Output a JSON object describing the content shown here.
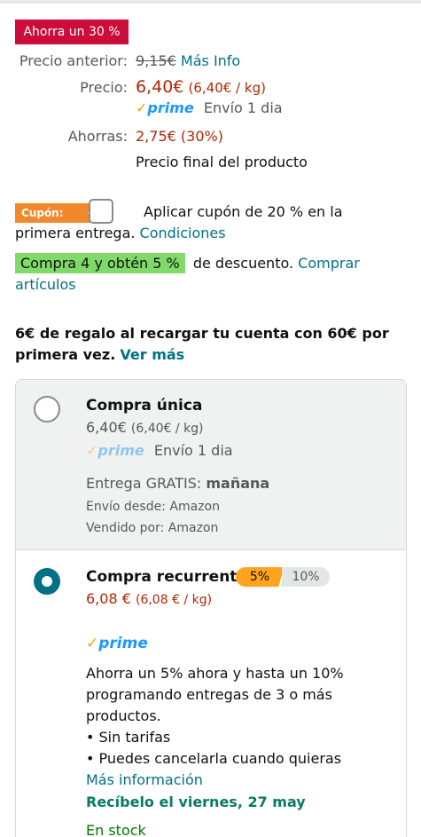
{
  "deal_badge": "Ahorra un 30 %",
  "pricing": {
    "previous_label": "Precio anterior:",
    "previous_value": "9,15€",
    "more_info": "Más Info",
    "price_label": "Precio:",
    "price_value": "6,40€",
    "price_unit": "(6,40€ / kg)",
    "prime_text": "prime",
    "delivery": "Envío 1 dia",
    "savings_label": "Ahorras:",
    "savings_value": "2,75€ (30%)",
    "final_note": "Precio final del producto"
  },
  "coupon": {
    "tag": "Cupón:",
    "text_line1": "Aplicar cupón de 20 % en la",
    "text_line2": "primera entrega.",
    "conditions": "Condiciones"
  },
  "multibuy": {
    "highlight": "Compra 4 y obtén 5 %",
    "rest": "de descuento.",
    "link1": "Comprar",
    "link2": "artículos"
  },
  "gift": {
    "line1": "6€ de regalo al recargar tu cuenta con 60€ por",
    "line2": "primera vez.",
    "link": "Ver más"
  },
  "one_time": {
    "title": "Compra única",
    "price": "6,40€",
    "unit": "(6,40€ / kg)",
    "prime_text": "prime",
    "delivery": "Envío 1 dia",
    "free_delivery_label": "Entrega GRATIS:",
    "free_delivery_day": "mañana",
    "shipped_from": "Envío desde: Amazon",
    "sold_by": "Vendido por: Amazon"
  },
  "recurring": {
    "title": "Compra recurrente",
    "pill_active": "5%",
    "pill_inactive": "10%",
    "price": "6,08 €",
    "unit": "(6,08 € / kg)",
    "prime_text": "prime",
    "desc_line1": "Ahorra un 5% ahora y hasta un 10%",
    "desc_line2": "programando entregas de 3 o más",
    "desc_line3": "productos.",
    "bullet1": "• Sin tarifas",
    "bullet2": "• Puedes cancelarla cuando quieras",
    "more_info": "Más información",
    "arrival": "Recíbelo el viernes, 27 may",
    "stock": "En stock"
  },
  "colors": {
    "deal_red": "#cc0c39",
    "price_red": "#b12704",
    "link_teal": "#007185",
    "prime_blue": "#1a98ff",
    "coupon_orange": "#f2872b",
    "highlight_green": "#7fda69",
    "arrival_green": "#067d62"
  }
}
